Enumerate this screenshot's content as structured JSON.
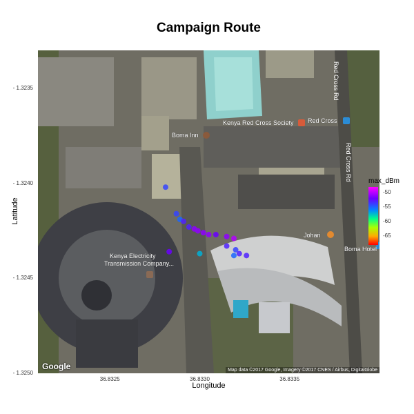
{
  "chart_data": {
    "type": "scatter",
    "title": "Campaign Route",
    "xlabel": "Longitude",
    "ylabel": "Latitude",
    "xlim": [
      36.8321,
      36.834
    ],
    "ylim": [
      -1.325,
      -1.3233
    ],
    "x_ticks": [
      {
        "value": 36.8325,
        "label": "36.8325"
      },
      {
        "value": 36.833,
        "label": "36.8330"
      },
      {
        "value": 36.8335,
        "label": "36.8335"
      }
    ],
    "y_ticks": [
      {
        "value": -1.3235,
        "label": "- 1.3235"
      },
      {
        "value": -1.324,
        "label": "- 1.3240"
      },
      {
        "value": -1.3245,
        "label": "- 1.3245"
      },
      {
        "value": -1.325,
        "label": "- 1.3250"
      }
    ],
    "color_scale": {
      "name": "max_dBm",
      "min": -68,
      "max": -48,
      "ticks": [
        {
          "value": -50,
          "label": "-50"
        },
        {
          "value": -55,
          "label": "-55"
        },
        {
          "value": -60,
          "label": "-60"
        },
        {
          "value": -65,
          "label": "-65"
        }
      ]
    },
    "points": [
      {
        "x": 36.83281,
        "y": -1.32402,
        "max_dBm": -54
      },
      {
        "x": 36.83287,
        "y": -1.32416,
        "max_dBm": -54
      },
      {
        "x": 36.83289,
        "y": -1.32419,
        "max_dBm": -55
      },
      {
        "x": 36.83291,
        "y": -1.3242,
        "max_dBm": -53
      },
      {
        "x": 36.83294,
        "y": -1.32423,
        "max_dBm": -53
      },
      {
        "x": 36.83297,
        "y": -1.32424,
        "max_dBm": -51
      },
      {
        "x": 36.83299,
        "y": -1.32425,
        "max_dBm": -51
      },
      {
        "x": 36.83302,
        "y": -1.32426,
        "max_dBm": -51
      },
      {
        "x": 36.83305,
        "y": -1.32427,
        "max_dBm": -51
      },
      {
        "x": 36.83309,
        "y": -1.32427,
        "max_dBm": -52
      },
      {
        "x": 36.83315,
        "y": -1.32428,
        "max_dBm": -51
      },
      {
        "x": 36.83319,
        "y": -1.32429,
        "max_dBm": -50
      },
      {
        "x": 36.83315,
        "y": -1.32433,
        "max_dBm": -53
      },
      {
        "x": 36.8332,
        "y": -1.32435,
        "max_dBm": -54
      },
      {
        "x": 36.83322,
        "y": -1.32437,
        "max_dBm": -53
      },
      {
        "x": 36.83326,
        "y": -1.32438,
        "max_dBm": -53
      },
      {
        "x": 36.83319,
        "y": -1.32438,
        "max_dBm": -55
      },
      {
        "x": 36.83283,
        "y": -1.32436,
        "max_dBm": -52
      },
      {
        "x": 36.833,
        "y": -1.32437,
        "max_dBm": -57
      }
    ]
  },
  "map": {
    "pois": {
      "boma_inn": "Boma Inn",
      "kenya_red_cross": "Kenya Red Cross Society",
      "red_cross": "Red Cross",
      "johari": "Johari",
      "boma_hotel": "Boma Hotel",
      "kenya_electricity_line1": "Kenya Electricity",
      "kenya_electricity_line2": "Transmission Company..."
    },
    "roads": {
      "road1": "Red Cross Rd",
      "road2": "Red Cross Rd"
    },
    "logo": "Google",
    "attribution": "Map data ©2017 Google, Imagery ©2017 CNES / Airbus, DigitalGlobe"
  }
}
